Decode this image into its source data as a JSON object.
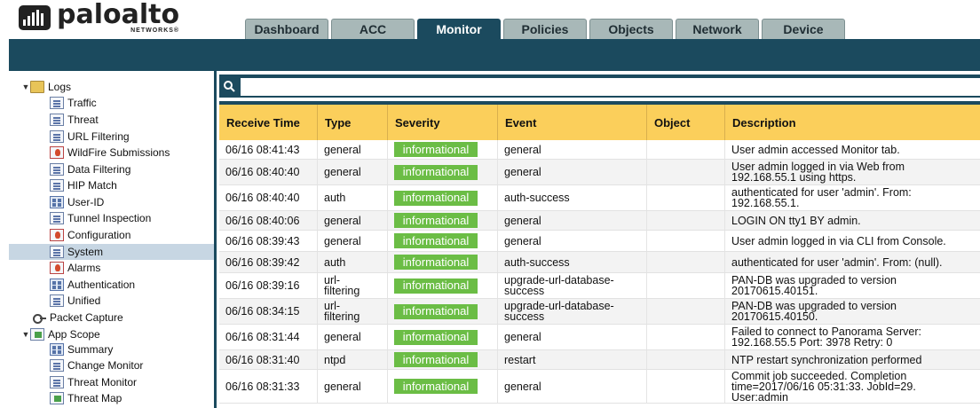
{
  "brand": {
    "name": "paloalto",
    "sub": "NETWORKS®"
  },
  "tabs": [
    {
      "label": "Dashboard",
      "active": false
    },
    {
      "label": "ACC",
      "active": false
    },
    {
      "label": "Monitor",
      "active": true
    },
    {
      "label": "Policies",
      "active": false
    },
    {
      "label": "Objects",
      "active": false
    },
    {
      "label": "Network",
      "active": false
    },
    {
      "label": "Device",
      "active": false
    }
  ],
  "sidebar": {
    "items": [
      {
        "label": "Logs",
        "icon": "folder-icon",
        "level": 0,
        "expanded": true
      },
      {
        "label": "Traffic",
        "icon": "log-icon",
        "level": 1
      },
      {
        "label": "Threat",
        "icon": "log-icon",
        "level": 1
      },
      {
        "label": "URL Filtering",
        "icon": "log-icon",
        "level": 1
      },
      {
        "label": "WildFire Submissions",
        "icon": "wildfire-icon",
        "level": 1
      },
      {
        "label": "Data Filtering",
        "icon": "log-icon",
        "level": 1
      },
      {
        "label": "HIP Match",
        "icon": "log-icon",
        "level": 1
      },
      {
        "label": "User-ID",
        "icon": "grid-icon",
        "level": 1
      },
      {
        "label": "Tunnel Inspection",
        "icon": "log-icon",
        "level": 1
      },
      {
        "label": "Configuration",
        "icon": "config-icon",
        "level": 1
      },
      {
        "label": "System",
        "icon": "log-icon",
        "level": 1,
        "selected": true
      },
      {
        "label": "Alarms",
        "icon": "alarm-icon",
        "level": 1
      },
      {
        "label": "Authentication",
        "icon": "grid-icon",
        "level": 1
      },
      {
        "label": "Unified",
        "icon": "log-icon",
        "level": 1
      },
      {
        "label": "Packet Capture",
        "icon": "key-icon",
        "level": 0
      },
      {
        "label": "App Scope",
        "icon": "folder-icon",
        "level": 0,
        "expanded": true
      },
      {
        "label": "Summary",
        "icon": "grid-icon",
        "level": 1
      },
      {
        "label": "Change Monitor",
        "icon": "log-icon",
        "level": 1
      },
      {
        "label": "Threat Monitor",
        "icon": "log-icon",
        "level": 1
      },
      {
        "label": "Threat Map",
        "icon": "map-icon",
        "level": 1
      }
    ]
  },
  "search": {
    "value": "",
    "placeholder": ""
  },
  "table": {
    "columns": [
      "Receive Time",
      "Type",
      "Severity",
      "Event",
      "Object",
      "Description"
    ],
    "rows": [
      {
        "time": "06/16 08:41:43",
        "type": [
          "general"
        ],
        "severity": "informational",
        "event": [
          "general"
        ],
        "object": "",
        "description": [
          "User admin accessed Monitor tab."
        ]
      },
      {
        "time": "06/16 08:40:40",
        "type": [
          "general"
        ],
        "severity": "informational",
        "event": [
          "general"
        ],
        "object": "",
        "description": [
          "User admin logged in via Web from",
          "192.168.55.1 using https."
        ]
      },
      {
        "time": "06/16 08:40:40",
        "type": [
          "auth"
        ],
        "severity": "informational",
        "event": [
          "auth-success"
        ],
        "object": "",
        "description": [
          "authenticated for user 'admin'. From:",
          "192.168.55.1."
        ]
      },
      {
        "time": "06/16 08:40:06",
        "type": [
          "general"
        ],
        "severity": "informational",
        "event": [
          "general"
        ],
        "object": "",
        "description": [
          "LOGIN ON tty1 BY admin."
        ]
      },
      {
        "time": "06/16 08:39:43",
        "type": [
          "general"
        ],
        "severity": "informational",
        "event": [
          "general"
        ],
        "object": "",
        "description": [
          "User admin logged in via CLI from Console."
        ]
      },
      {
        "time": "06/16 08:39:42",
        "type": [
          "auth"
        ],
        "severity": "informational",
        "event": [
          "auth-success"
        ],
        "object": "",
        "description": [
          "authenticated for user 'admin'. From: (null)."
        ]
      },
      {
        "time": "06/16 08:39:16",
        "type": [
          "url-",
          "filtering"
        ],
        "severity": "informational",
        "event": [
          "upgrade-url-database-",
          "success"
        ],
        "object": "",
        "description": [
          "PAN-DB was upgraded to version",
          "20170615.40151."
        ]
      },
      {
        "time": "06/16 08:34:15",
        "type": [
          "url-",
          "filtering"
        ],
        "severity": "informational",
        "event": [
          "upgrade-url-database-",
          "success"
        ],
        "object": "",
        "description": [
          "PAN-DB was upgraded to version",
          "20170615.40150."
        ]
      },
      {
        "time": "06/16 08:31:44",
        "type": [
          "general"
        ],
        "severity": "informational",
        "event": [
          "general"
        ],
        "object": "",
        "description": [
          "Failed to connect to Panorama Server:",
          "192.168.55.5 Port: 3978 Retry: 0"
        ]
      },
      {
        "time": "06/16 08:31:40",
        "type": [
          "ntpd"
        ],
        "severity": "informational",
        "event": [
          "restart"
        ],
        "object": "",
        "description": [
          "NTP restart synchronization performed"
        ]
      },
      {
        "time": "06/16 08:31:33",
        "type": [
          "general"
        ],
        "severity": "informational",
        "event": [
          "general"
        ],
        "object": "",
        "description": [
          "Commit job succeeded. Completion",
          "time=2017/06/16 05:31:33. JobId=29.",
          "User:admin"
        ]
      }
    ]
  },
  "colors": {
    "brand_dark": "#1b4a5e",
    "header_yellow": "#fbcf5b",
    "severity_green": "#6bbd45",
    "tab_inactive": "#a8b8b8"
  }
}
